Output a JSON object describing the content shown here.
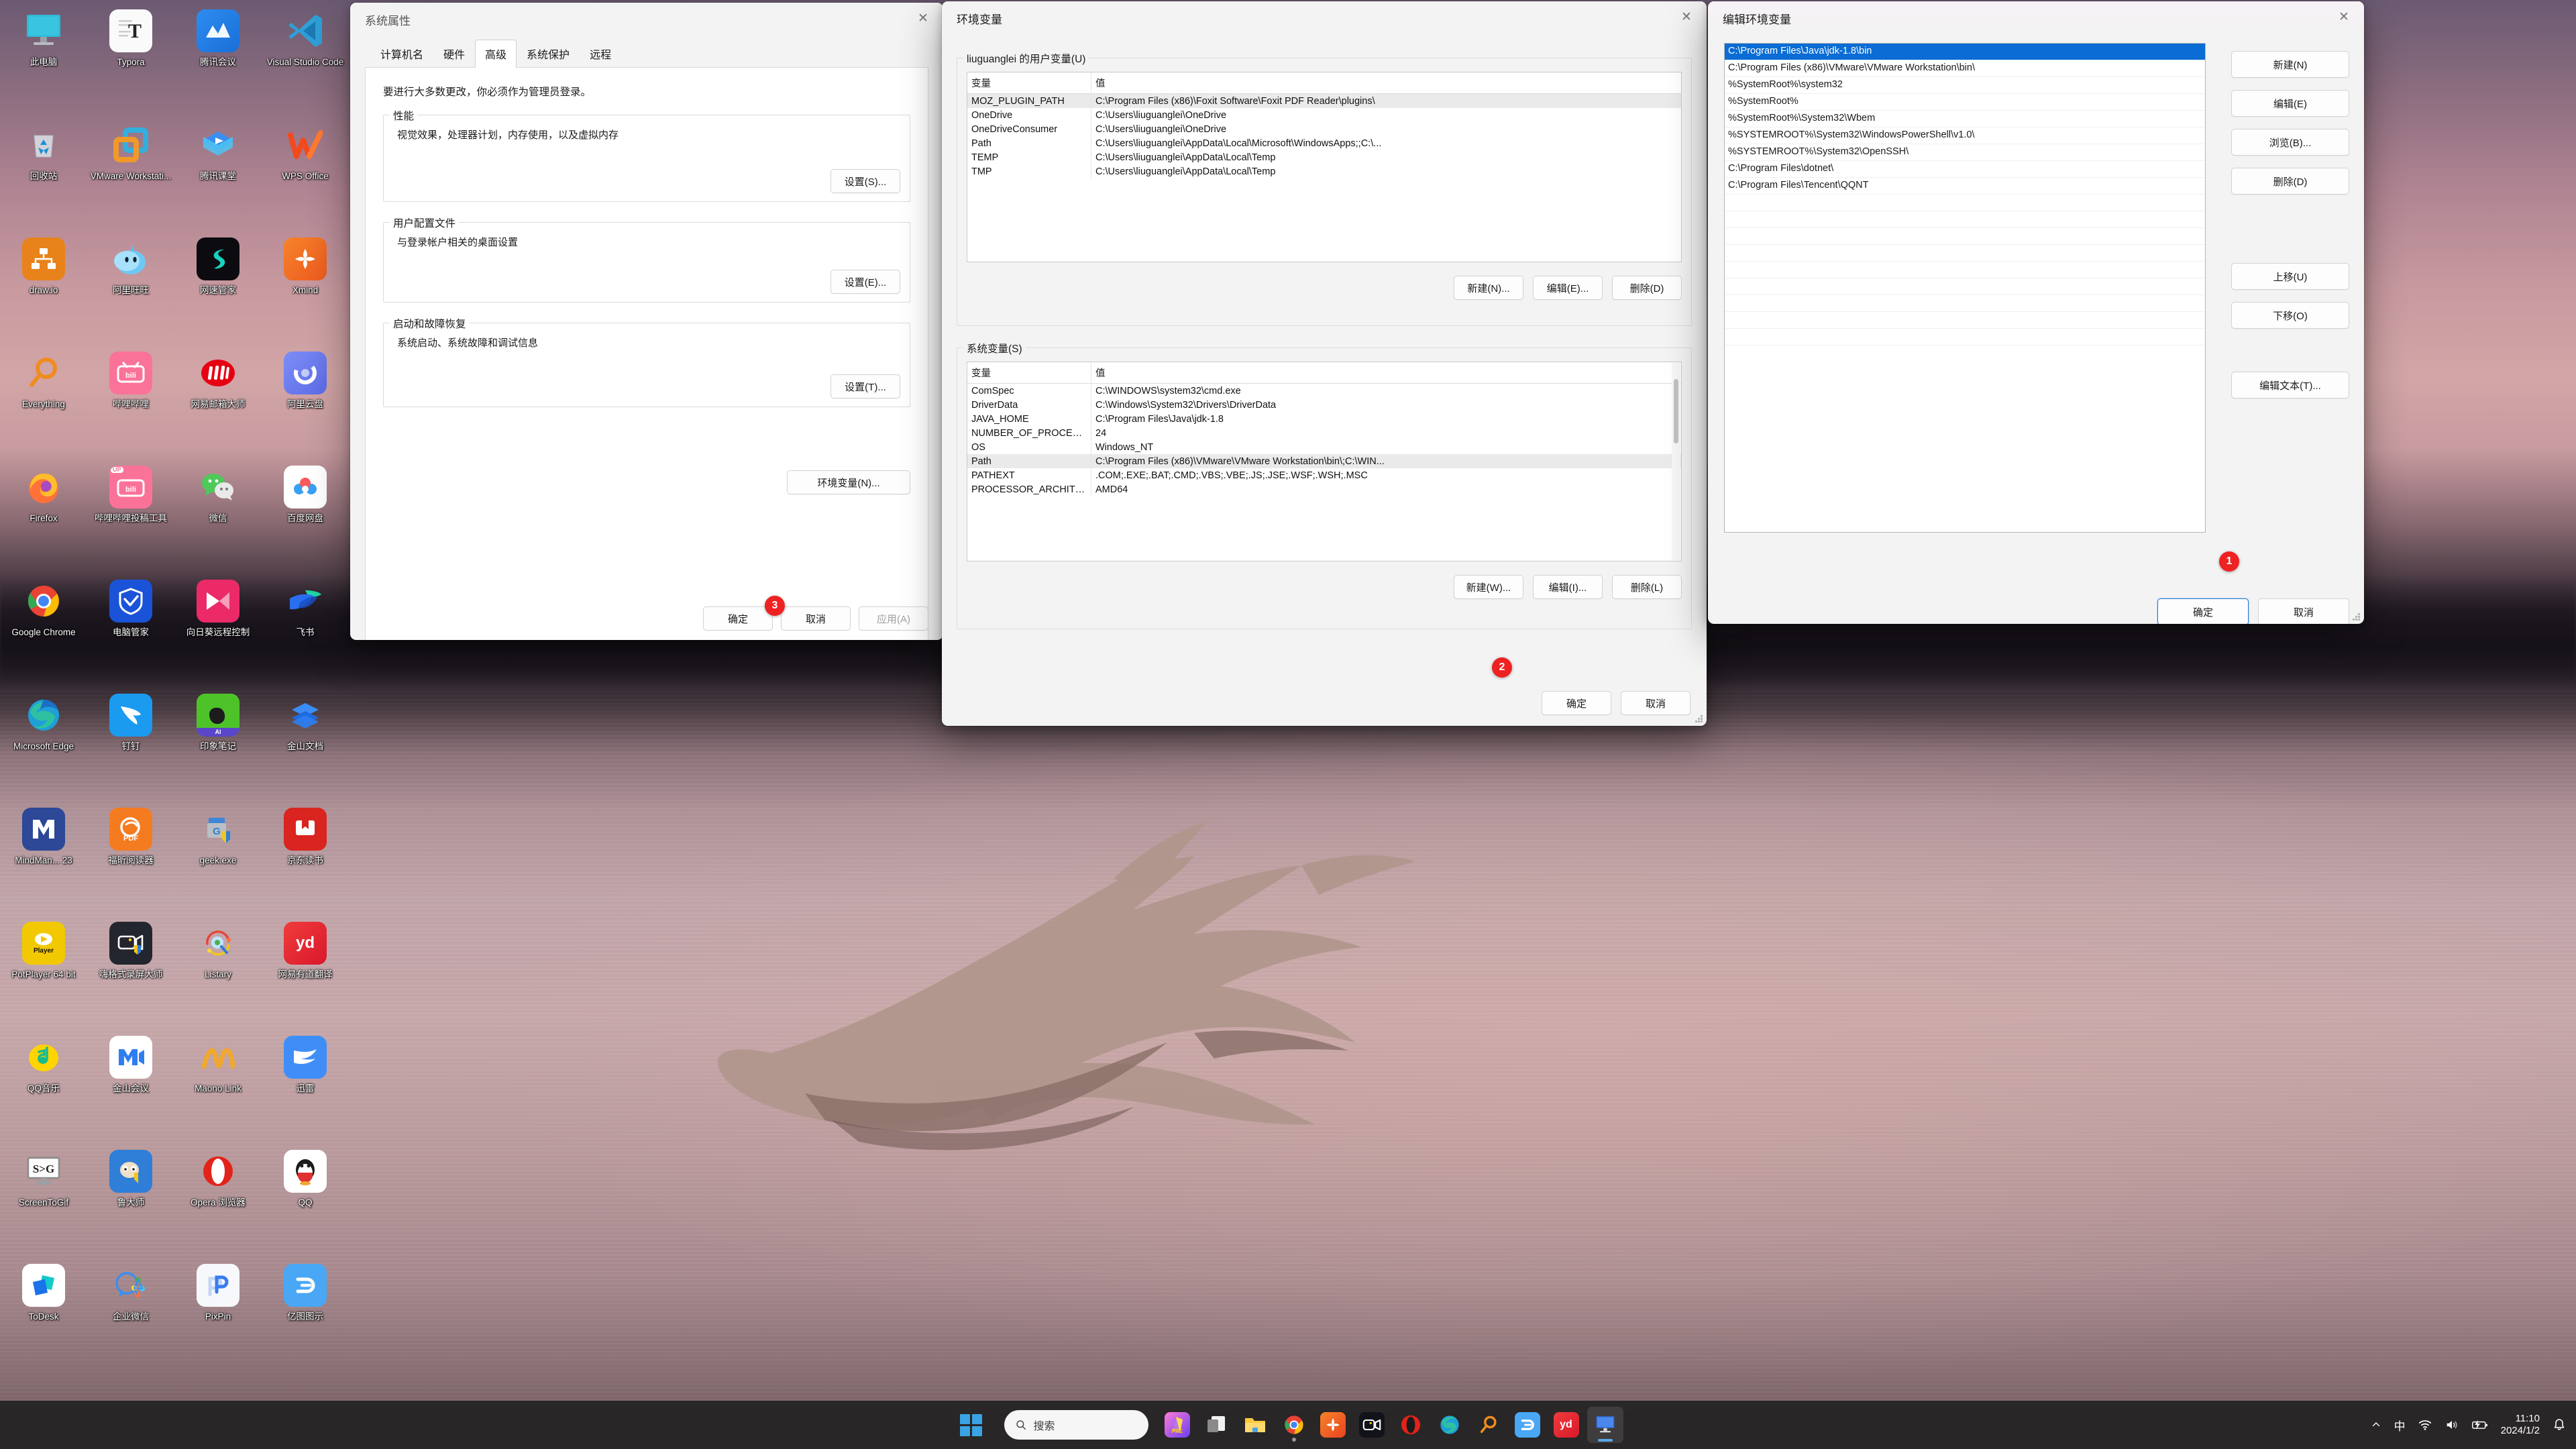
{
  "desktop": {
    "icons": [
      {
        "label": "此电脑",
        "icon": "this-pc-icon",
        "kind": "monitor"
      },
      {
        "label": "Typora",
        "icon": "typora-icon",
        "kind": "typora"
      },
      {
        "label": "腾讯会议",
        "icon": "tencent-meeting-icon",
        "kind": "tmeeting"
      },
      {
        "label": "Visual Studio Code",
        "icon": "vscode-icon",
        "kind": "vscode"
      },
      {
        "label": "回收站",
        "icon": "recycle-bin-icon",
        "kind": "recycle"
      },
      {
        "label": "VMware Workstati...",
        "icon": "vmware-icon",
        "kind": "vmware"
      },
      {
        "label": "腾讯课堂",
        "icon": "tencent-ketang-icon",
        "kind": "ketang"
      },
      {
        "label": "WPS Office",
        "icon": "wps-office-icon",
        "kind": "wps"
      },
      {
        "label": "draw.io",
        "icon": "drawio-icon",
        "kind": "drawio"
      },
      {
        "label": "阿里旺旺",
        "icon": "aliwangwang-icon",
        "kind": "wangwang"
      },
      {
        "label": "网速管家",
        "icon": "netspeed-icon",
        "kind": "netspeed"
      },
      {
        "label": "Xmind",
        "icon": "xmind-icon",
        "kind": "xmind"
      },
      {
        "label": "Everything",
        "icon": "everything-icon",
        "kind": "everything"
      },
      {
        "label": "哔哩哔哩",
        "icon": "bilibili-icon",
        "kind": "bili"
      },
      {
        "label": "网易邮箱大师",
        "icon": "netease-mail-icon",
        "kind": "neteasemail"
      },
      {
        "label": "阿里云盘",
        "icon": "aliyun-drive-icon",
        "kind": "aliyun"
      },
      {
        "label": "Firefox",
        "icon": "firefox-icon",
        "kind": "firefox"
      },
      {
        "label": "哔哩哔哩投稿工具",
        "icon": "bilibili-upload-icon",
        "kind": "biliup"
      },
      {
        "label": "微信",
        "icon": "wechat-icon",
        "kind": "wechat"
      },
      {
        "label": "百度网盘",
        "icon": "baidu-netdisk-icon",
        "kind": "baidu"
      },
      {
        "label": "Google Chrome",
        "icon": "chrome-icon",
        "kind": "chrome"
      },
      {
        "label": "电脑管家",
        "icon": "pc-manager-icon",
        "kind": "pcmgr"
      },
      {
        "label": "向日葵远程控制",
        "icon": "sunlogin-icon",
        "kind": "sunlogin"
      },
      {
        "label": "飞书",
        "icon": "feishu-icon",
        "kind": "feishu"
      },
      {
        "label": "Microsoft Edge",
        "icon": "edge-icon",
        "kind": "edge"
      },
      {
        "label": "钉钉",
        "icon": "dingtalk-icon",
        "kind": "dingtalk"
      },
      {
        "label": "印象笔记",
        "icon": "evernote-icon",
        "kind": "evernote"
      },
      {
        "label": "金山文档",
        "icon": "kingsoft-doc-icon",
        "kind": "ksdoc"
      },
      {
        "label": "MindMan... 23",
        "icon": "mindmanager-icon",
        "kind": "mindmanager"
      },
      {
        "label": "福昕阅读器",
        "icon": "foxit-reader-icon",
        "kind": "foxit"
      },
      {
        "label": "geek.exe",
        "icon": "geek-uninstaller-icon",
        "kind": "geek"
      },
      {
        "label": "京东读书",
        "icon": "jd-read-icon",
        "kind": "jdread"
      },
      {
        "label": "PotPlayer 64 bit",
        "icon": "potplayer-icon",
        "kind": "potplayer"
      },
      {
        "label": "嗨格式录屏大师",
        "icon": "higeshi-recorder-icon",
        "kind": "higeshi"
      },
      {
        "label": "Listary",
        "icon": "listary-icon",
        "kind": "listary"
      },
      {
        "label": "网易有道翻译",
        "icon": "youdao-icon",
        "kind": "youdao"
      },
      {
        "label": "QQ音乐",
        "icon": "qq-music-icon",
        "kind": "qqmusic"
      },
      {
        "label": "金山会议",
        "icon": "kingsoft-meeting-icon",
        "kind": "ksmeeting"
      },
      {
        "label": "Maono Link",
        "icon": "maono-link-icon",
        "kind": "maono"
      },
      {
        "label": "迅雷",
        "icon": "xunlei-icon",
        "kind": "xunlei"
      },
      {
        "label": "ScreenToGif",
        "icon": "screentogif-icon",
        "kind": "s2g"
      },
      {
        "label": "鲁大师",
        "icon": "ludashi-icon",
        "kind": "ludashi"
      },
      {
        "label": "Opera 浏览器",
        "icon": "opera-icon",
        "kind": "opera"
      },
      {
        "label": "QQ",
        "icon": "qq-icon",
        "kind": "qq"
      },
      {
        "label": "ToDesk",
        "icon": "todesk-icon",
        "kind": "todesk"
      },
      {
        "label": "企业微信",
        "icon": "wecom-icon",
        "kind": "wecom"
      },
      {
        "label": "PixPin",
        "icon": "pixpin-icon",
        "kind": "pixpin"
      },
      {
        "label": "亿图图示",
        "icon": "edraw-icon",
        "kind": "edraw"
      }
    ]
  },
  "system_properties": {
    "title": "系统属性",
    "close_label": "✕",
    "tabs": [
      {
        "label": "计算机名",
        "selected": false
      },
      {
        "label": "硬件",
        "selected": false
      },
      {
        "label": "高级",
        "selected": true
      },
      {
        "label": "系统保护",
        "selected": false
      },
      {
        "label": "远程",
        "selected": false
      }
    ],
    "notice": "要进行大多数更改，你必须作为管理员登录。",
    "groups": [
      {
        "legend": "性能",
        "desc": "视觉效果，处理器计划，内存使用，以及虚拟内存",
        "button": "设置(S)..."
      },
      {
        "legend": "用户配置文件",
        "desc": "与登录帐户相关的桌面设置",
        "button": "设置(E)..."
      },
      {
        "legend": "启动和故障恢复",
        "desc": "系统启动、系统故障和调试信息",
        "button": "设置(T)..."
      }
    ],
    "env_button": "环境变量(N)...",
    "footer": {
      "ok": "确定",
      "cancel": "取消",
      "apply": "应用(A)"
    },
    "badge": "3"
  },
  "env_vars": {
    "title": "环境变量",
    "close_label": "✕",
    "user_group_legend": "liuguanglei 的用户变量(U)",
    "system_group_legend": "系统变量(S)",
    "columns": {
      "variable": "变量",
      "value": "值"
    },
    "user_rows": [
      {
        "variable": "MOZ_PLUGIN_PATH",
        "value": "C:\\Program Files (x86)\\Foxit Software\\Foxit PDF Reader\\plugins\\",
        "selected": true
      },
      {
        "variable": "OneDrive",
        "value": "C:\\Users\\liuguanglei\\OneDrive",
        "selected": false
      },
      {
        "variable": "OneDriveConsumer",
        "value": "C:\\Users\\liuguanglei\\OneDrive",
        "selected": false
      },
      {
        "variable": "Path",
        "value": "C:\\Users\\liuguanglei\\AppData\\Local\\Microsoft\\WindowsApps;;C:\\...",
        "selected": false
      },
      {
        "variable": "TEMP",
        "value": "C:\\Users\\liuguanglei\\AppData\\Local\\Temp",
        "selected": false
      },
      {
        "variable": "TMP",
        "value": "C:\\Users\\liuguanglei\\AppData\\Local\\Temp",
        "selected": false
      }
    ],
    "user_buttons": {
      "new": "新建(N)...",
      "edit": "编辑(E)...",
      "delete": "删除(D)"
    },
    "system_rows": [
      {
        "variable": "ComSpec",
        "value": "C:\\WINDOWS\\system32\\cmd.exe",
        "selected": false
      },
      {
        "variable": "DriverData",
        "value": "C:\\Windows\\System32\\Drivers\\DriverData",
        "selected": false
      },
      {
        "variable": "JAVA_HOME",
        "value": "C:\\Program Files\\Java\\jdk-1.8",
        "selected": false
      },
      {
        "variable": "NUMBER_OF_PROCESSORS",
        "value": "24",
        "selected": false
      },
      {
        "variable": "OS",
        "value": "Windows_NT",
        "selected": false
      },
      {
        "variable": "Path",
        "value": "C:\\Program Files (x86)\\VMware\\VMware Workstation\\bin\\;C:\\WIN...",
        "selected": true
      },
      {
        "variable": "PATHEXT",
        "value": ".COM;.EXE;.BAT;.CMD;.VBS;.VBE;.JS;.JSE;.WSF;.WSH;.MSC",
        "selected": false
      },
      {
        "variable": "PROCESSOR_ARCHITECTURE",
        "value": "AMD64",
        "selected": false
      }
    ],
    "system_buttons": {
      "new": "新建(W)...",
      "edit": "编辑(I)...",
      "delete": "删除(L)"
    },
    "footer": {
      "ok": "确定",
      "cancel": "取消"
    },
    "badge": "2"
  },
  "edit_env": {
    "title": "编辑环境变量",
    "close_label": "✕",
    "paths": [
      {
        "value": "C:\\Program Files\\Java\\jdk-1.8\\bin",
        "selected": true
      },
      {
        "value": "C:\\Program Files (x86)\\VMware\\VMware Workstation\\bin\\",
        "selected": false
      },
      {
        "value": "%SystemRoot%\\system32",
        "selected": false
      },
      {
        "value": "%SystemRoot%",
        "selected": false
      },
      {
        "value": "%SystemRoot%\\System32\\Wbem",
        "selected": false
      },
      {
        "value": "%SYSTEMROOT%\\System32\\WindowsPowerShell\\v1.0\\",
        "selected": false
      },
      {
        "value": "%SYSTEMROOT%\\System32\\OpenSSH\\",
        "selected": false
      },
      {
        "value": "C:\\Program Files\\dotnet\\",
        "selected": false
      },
      {
        "value": "C:\\Program Files\\Tencent\\QQNT",
        "selected": false
      },
      {
        "value": "",
        "selected": false
      },
      {
        "value": "",
        "selected": false
      },
      {
        "value": "",
        "selected": false
      },
      {
        "value": "",
        "selected": false
      },
      {
        "value": "",
        "selected": false
      },
      {
        "value": "",
        "selected": false
      },
      {
        "value": "",
        "selected": false
      },
      {
        "value": "",
        "selected": false
      },
      {
        "value": "",
        "selected": false
      }
    ],
    "side_buttons": [
      {
        "label": "新建(N)",
        "name": "new-path-button"
      },
      {
        "label": "编辑(E)",
        "name": "edit-path-button"
      },
      {
        "label": "浏览(B)...",
        "name": "browse-path-button"
      },
      {
        "label": "删除(D)",
        "name": "delete-path-button"
      },
      {
        "label": "上移(U)",
        "name": "move-up-button"
      },
      {
        "label": "下移(O)",
        "name": "move-down-button"
      },
      {
        "label": "编辑文本(T)...",
        "name": "edit-text-button"
      }
    ],
    "footer": {
      "ok": "确定",
      "cancel": "取消"
    },
    "badge": "1"
  },
  "taskbar": {
    "search_placeholder": "搜索",
    "start_label": "start-button",
    "items": [
      {
        "name": "tb-premiere",
        "kind": "premiere",
        "open": false
      },
      {
        "name": "tb-taskview",
        "kind": "taskview",
        "open": false
      },
      {
        "name": "tb-fileexplorer",
        "kind": "explorer",
        "open": false
      },
      {
        "name": "tb-chrome",
        "kind": "chrome",
        "open": false,
        "dot": true
      },
      {
        "name": "tb-xmind",
        "kind": "xmind",
        "open": false
      },
      {
        "name": "tb-meeting",
        "kind": "meeting",
        "open": false
      },
      {
        "name": "tb-opera",
        "kind": "opera",
        "open": false
      },
      {
        "name": "tb-edge",
        "kind": "edge",
        "open": false
      },
      {
        "name": "tb-everything",
        "kind": "everything",
        "open": false
      },
      {
        "name": "tb-edraw",
        "kind": "edraw",
        "open": false
      },
      {
        "name": "tb-youdao",
        "kind": "youdao",
        "open": false
      },
      {
        "name": "tb-thispc",
        "kind": "thispc",
        "open": true
      }
    ],
    "tray": {
      "chevron": "^",
      "ime": "中",
      "wifi": "wifi-icon",
      "volume": "volume-icon",
      "battery": "battery-charging-icon",
      "time": "11:10",
      "date": "2024/1/2",
      "notifications": "bell-icon"
    }
  }
}
